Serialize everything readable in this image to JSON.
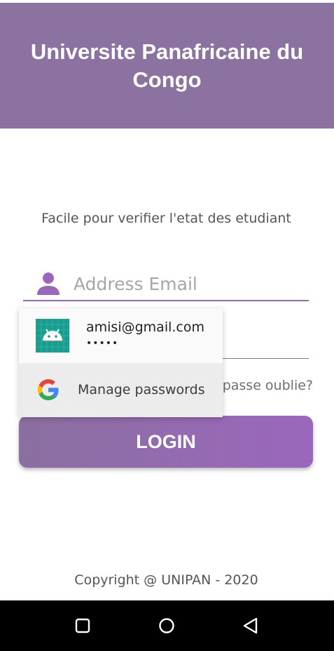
{
  "header": {
    "title": "Universite Panafricaine du Congo",
    "background_color": "#8b72a0"
  },
  "subtitle": "Facile pour verifier l'etat des etudiant",
  "email_field": {
    "placeholder": "Address Email",
    "value": "",
    "icon": "person-icon",
    "accent_color": "#9b67bd"
  },
  "password_field": {
    "value": ""
  },
  "forgot_password": {
    "label": "passe oublie?"
  },
  "login_button": {
    "label": "LOGIN"
  },
  "autofill_popup": {
    "account": {
      "email": "amisi@gmail.com",
      "masked_password": "•••••",
      "icon": "android-icon"
    },
    "manage": {
      "label": "Manage passwords",
      "icon": "google-icon"
    }
  },
  "footer": {
    "copyright": "Copyright @ UNIPAN - 2020"
  },
  "navbar": {
    "buttons": [
      "recents-icon",
      "home-icon",
      "back-icon"
    ]
  }
}
